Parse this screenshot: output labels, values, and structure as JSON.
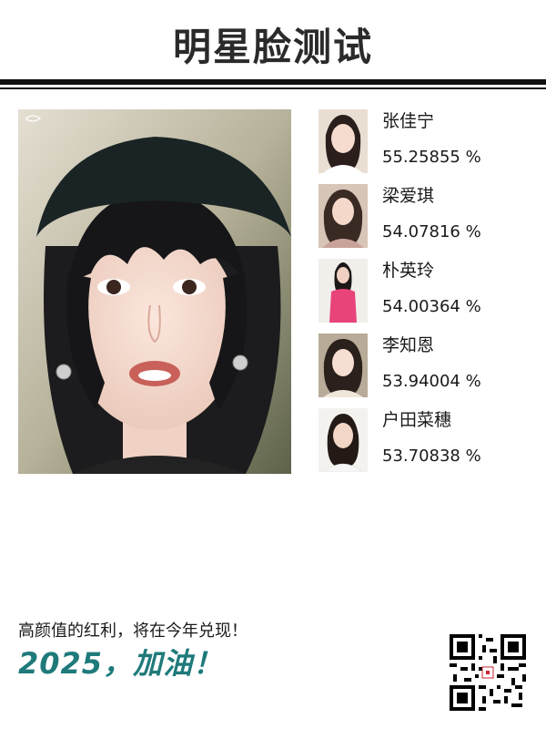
{
  "header": {
    "title": "明星脸测试"
  },
  "main_photo": {
    "alt": "uploaded-face-photo"
  },
  "results": [
    {
      "name": "张佳宁",
      "score": "55.25855 %",
      "thumb_bg": "#e9ded2",
      "shirt": "#ffffff"
    },
    {
      "name": "梁爱琪",
      "score": "54.07816 %",
      "thumb_bg": "#d7c5b8",
      "shirt": "#c9a39a"
    },
    {
      "name": "朴英玲",
      "score": "54.00364 %",
      "thumb_bg": "#f2eeea",
      "shirt": "#e8447a"
    },
    {
      "name": "李知恩",
      "score": "53.94004 %",
      "thumb_bg": "#b8ab98",
      "shirt": "#efe6da"
    },
    {
      "name": "户田菜穗",
      "score": "53.70838 %",
      "thumb_bg": "#f4f2ef",
      "shirt": "#f7f7f7"
    }
  ],
  "footer": {
    "slogan": "高颜值的红利，将在今年兑现！",
    "motto": "2025，加油！"
  },
  "colors": {
    "accent": "#1f7a7a",
    "rule": "#111111"
  },
  "icons": {
    "qr": "qr-code-icon"
  }
}
